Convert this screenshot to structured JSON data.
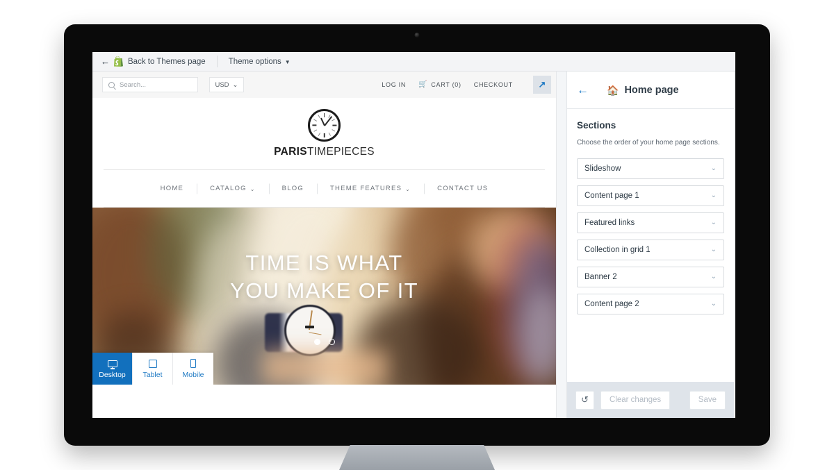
{
  "admin_bar": {
    "back_label": "Back to Themes page",
    "theme_options_label": "Theme options",
    "caret": "▼",
    "back_arrow": "←",
    "shopify_icon": "shopify-bag-icon"
  },
  "storefront": {
    "search": {
      "placeholder": "Search...",
      "value": ""
    },
    "currency": {
      "selected": "USD",
      "caret": "⌄"
    },
    "links": [
      {
        "name": "log-in",
        "label": "LOG IN",
        "icon": ""
      },
      {
        "name": "cart",
        "label": "CART (0)",
        "icon": "🛒"
      },
      {
        "name": "checkout",
        "label": "CHECKOUT",
        "icon": ""
      }
    ],
    "popout_icon": "↗",
    "logo": {
      "bold": "PARIS",
      "light": "TIMEPIECES",
      "mark": "clock-icon"
    },
    "nav": [
      {
        "label": "HOME",
        "caret": ""
      },
      {
        "label": "CATALOG",
        "caret": "⌄"
      },
      {
        "label": "BLOG",
        "caret": ""
      },
      {
        "label": "THEME FEATURES",
        "caret": "⌄"
      },
      {
        "label": "CONTACT US",
        "caret": ""
      }
    ],
    "hero": {
      "line1": "TIME IS WHAT",
      "line2": "YOU MAKE OF IT",
      "slides_total": 2,
      "slide_active": 1
    }
  },
  "device_bar": [
    {
      "label": "Desktop",
      "icon": "desktop-icon",
      "active": true
    },
    {
      "label": "Tablet",
      "icon": "tablet-icon",
      "active": false
    },
    {
      "label": "Mobile",
      "icon": "mobile-icon",
      "active": false
    }
  ],
  "sidebar": {
    "back_arrow": "←",
    "home_icon": "🏠",
    "title": "Home page",
    "heading": "Sections",
    "description": "Choose the order of your home page sections.",
    "sections": [
      {
        "label": "Slideshow",
        "chev": "⌄"
      },
      {
        "label": "Content page 1",
        "chev": "⌄"
      },
      {
        "label": "Featured links",
        "chev": "⌄"
      },
      {
        "label": "Collection in grid 1",
        "chev": "⌄"
      },
      {
        "label": "Banner 2",
        "chev": "⌄"
      },
      {
        "label": "Content page 2",
        "chev": "⌄"
      }
    ],
    "footer": {
      "undo_icon": "↺",
      "clear_label": "Clear changes",
      "save_label": "Save"
    }
  },
  "colors": {
    "accent_blue": "#1270bd",
    "link_blue": "#1878c6",
    "admin_bg": "#f3f4f6",
    "sidebar_footer": "#dfe4ea",
    "shopify_green": "#95bf47"
  }
}
